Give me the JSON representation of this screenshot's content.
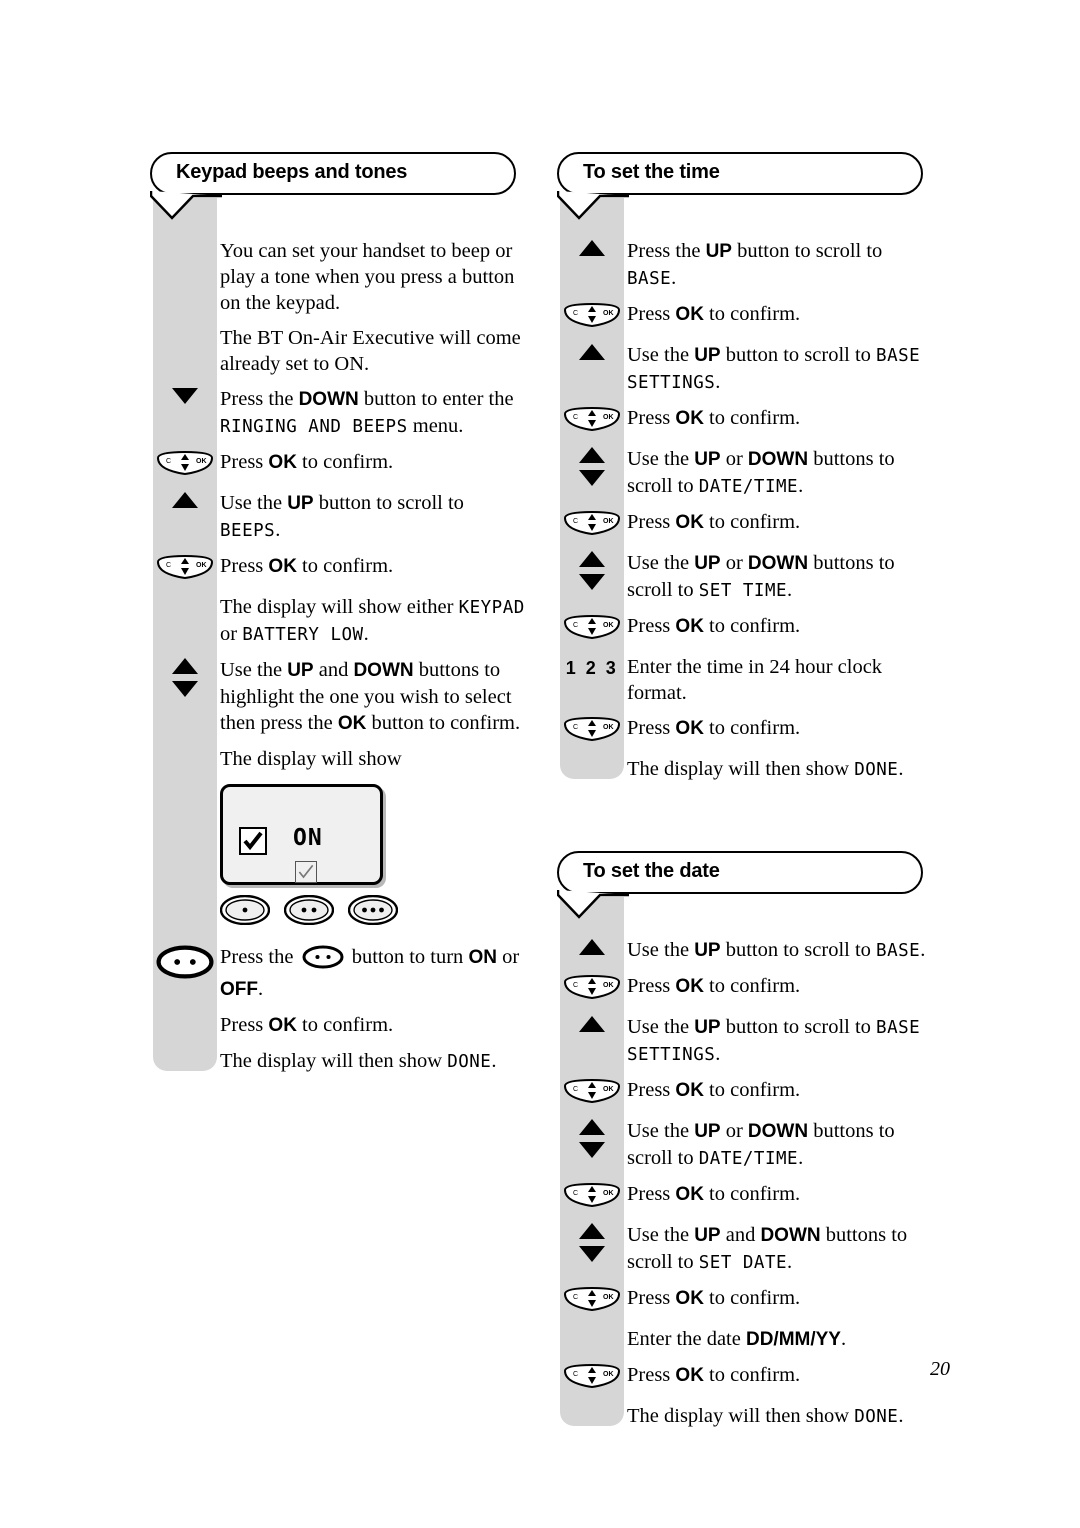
{
  "page": {
    "number": "20"
  },
  "sections": [
    {
      "id": "keypad-beeps",
      "title": "Keypad beeps and tones",
      "column": "left",
      "steps": [
        {
          "icon": "none",
          "html": "You can set your handset to beep or play a tone when you press a button on the keypad."
        },
        {
          "icon": "none",
          "html": "The BT On-Air Executive will come already set to ON."
        },
        {
          "icon": "down-arrow",
          "html": "Press the <b>DOWN</b> button to enter the <lcd>RINGING AND BEEPS</lcd> menu."
        },
        {
          "icon": "ok-button",
          "html": "Press <b>OK</b> to confirm."
        },
        {
          "icon": "up-arrow",
          "html": "Use the <b>UP</b> button to scroll to <lcd>BEEPS</lcd>."
        },
        {
          "icon": "ok-button",
          "html": "Press <b>OK</b> to confirm."
        },
        {
          "icon": "none",
          "html": "The display will show either <lcd>KEYPAD</lcd> or <lcd>BATTERY LOW</lcd>."
        },
        {
          "icon": "up-down-arrows",
          "html": "Use the <b>UP</b> and <b>DOWN</b> buttons to highlight the one you wish to select then press the <b>OK</b> button to confirm."
        },
        {
          "icon": "none",
          "html": "The display will show"
        }
      ],
      "display": {
        "label_on": "ON",
        "checkbox_selected": true,
        "checkbox_unselected": true
      },
      "softkeys": [
        {
          "name": "softkey-one-dot",
          "dots": 1
        },
        {
          "name": "softkey-two-dots",
          "dots": 2
        },
        {
          "name": "softkey-three-dots",
          "dots": 3
        }
      ],
      "steps_after": [
        {
          "icon": "two-dot-button",
          "html": "Press the <oval2></oval2> button to turn <b>ON</b> or <b>OFF</b>."
        },
        {
          "icon": "none",
          "html": "Press <b>OK</b> to confirm."
        },
        {
          "icon": "none",
          "html": "The display will then show <lcd>DONE</lcd>."
        }
      ]
    },
    {
      "id": "set-the-time",
      "title": "To set the time",
      "column": "right",
      "steps": [
        {
          "icon": "up-arrow",
          "html": "Press the <b>UP</b> button to scroll to <lcd>BASE</lcd>."
        },
        {
          "icon": "ok-button",
          "html": "Press <b>OK</b> to confirm."
        },
        {
          "icon": "up-arrow",
          "html": "Use the <b>UP</b> button to scroll to <lcd>BASE SETTINGS</lcd>."
        },
        {
          "icon": "ok-button",
          "html": "Press <b>OK</b> to confirm."
        },
        {
          "icon": "up-down-arrows",
          "html": "Use the <b>UP</b> or <b>DOWN</b> buttons to scroll to <lcd>DATE/TIME</lcd>."
        },
        {
          "icon": "ok-button",
          "html": "Press <b>OK</b> to confirm."
        },
        {
          "icon": "up-down-arrows",
          "html": "Use the <b>UP</b> or <b>DOWN</b> buttons to scroll to <lcd>SET TIME</lcd>."
        },
        {
          "icon": "ok-button",
          "html": "Press <b>OK</b> to confirm."
        },
        {
          "icon": "keypad-123",
          "html": "Enter the time in 24 hour clock format."
        },
        {
          "icon": "ok-button",
          "html": "Press <b>OK</b> to confirm."
        },
        {
          "icon": "none",
          "html": "The display will then show <lcd>DONE</lcd>."
        }
      ]
    },
    {
      "id": "set-the-date",
      "title": "To set the date",
      "column": "right",
      "steps": [
        {
          "icon": "up-arrow",
          "html": "Use the <b>UP</b> button to scroll to <lcd>BASE</lcd>."
        },
        {
          "icon": "ok-button",
          "html": "Press <b>OK</b> to confirm."
        },
        {
          "icon": "up-arrow",
          "html": "Use the <b>UP</b> button to scroll to <lcd>BASE SETTINGS</lcd>."
        },
        {
          "icon": "ok-button",
          "html": "Press <b>OK</b> to confirm."
        },
        {
          "icon": "up-down-arrows",
          "html": "Use the <b>UP</b> or <b>DOWN</b> buttons to scroll to <lcd>DATE/TIME</lcd>."
        },
        {
          "icon": "ok-button",
          "html": "Press <b>OK</b> to confirm."
        },
        {
          "icon": "up-down-arrows",
          "html": "Use the <b>UP</b> and <b>DOWN</b> buttons to scroll to <lcd>SET DATE</lcd>."
        },
        {
          "icon": "ok-button",
          "html": "Press <b>OK</b> to confirm."
        },
        {
          "icon": "none",
          "html": "Enter the date <b>DD/MM/YY</b>."
        },
        {
          "icon": "ok-button",
          "html": "Press <b>OK</b> to confirm."
        },
        {
          "icon": "none",
          "html": "The display will then show <lcd>DONE</lcd>."
        }
      ]
    }
  ],
  "icon_labels": {
    "ok_button_left": "C",
    "ok_button_right": "OK",
    "keypad_123": "1 2 3"
  },
  "colors": {
    "grey_band": "#d6d6d6",
    "lcd_background": "#f0f0f0",
    "ink": "#000000"
  }
}
